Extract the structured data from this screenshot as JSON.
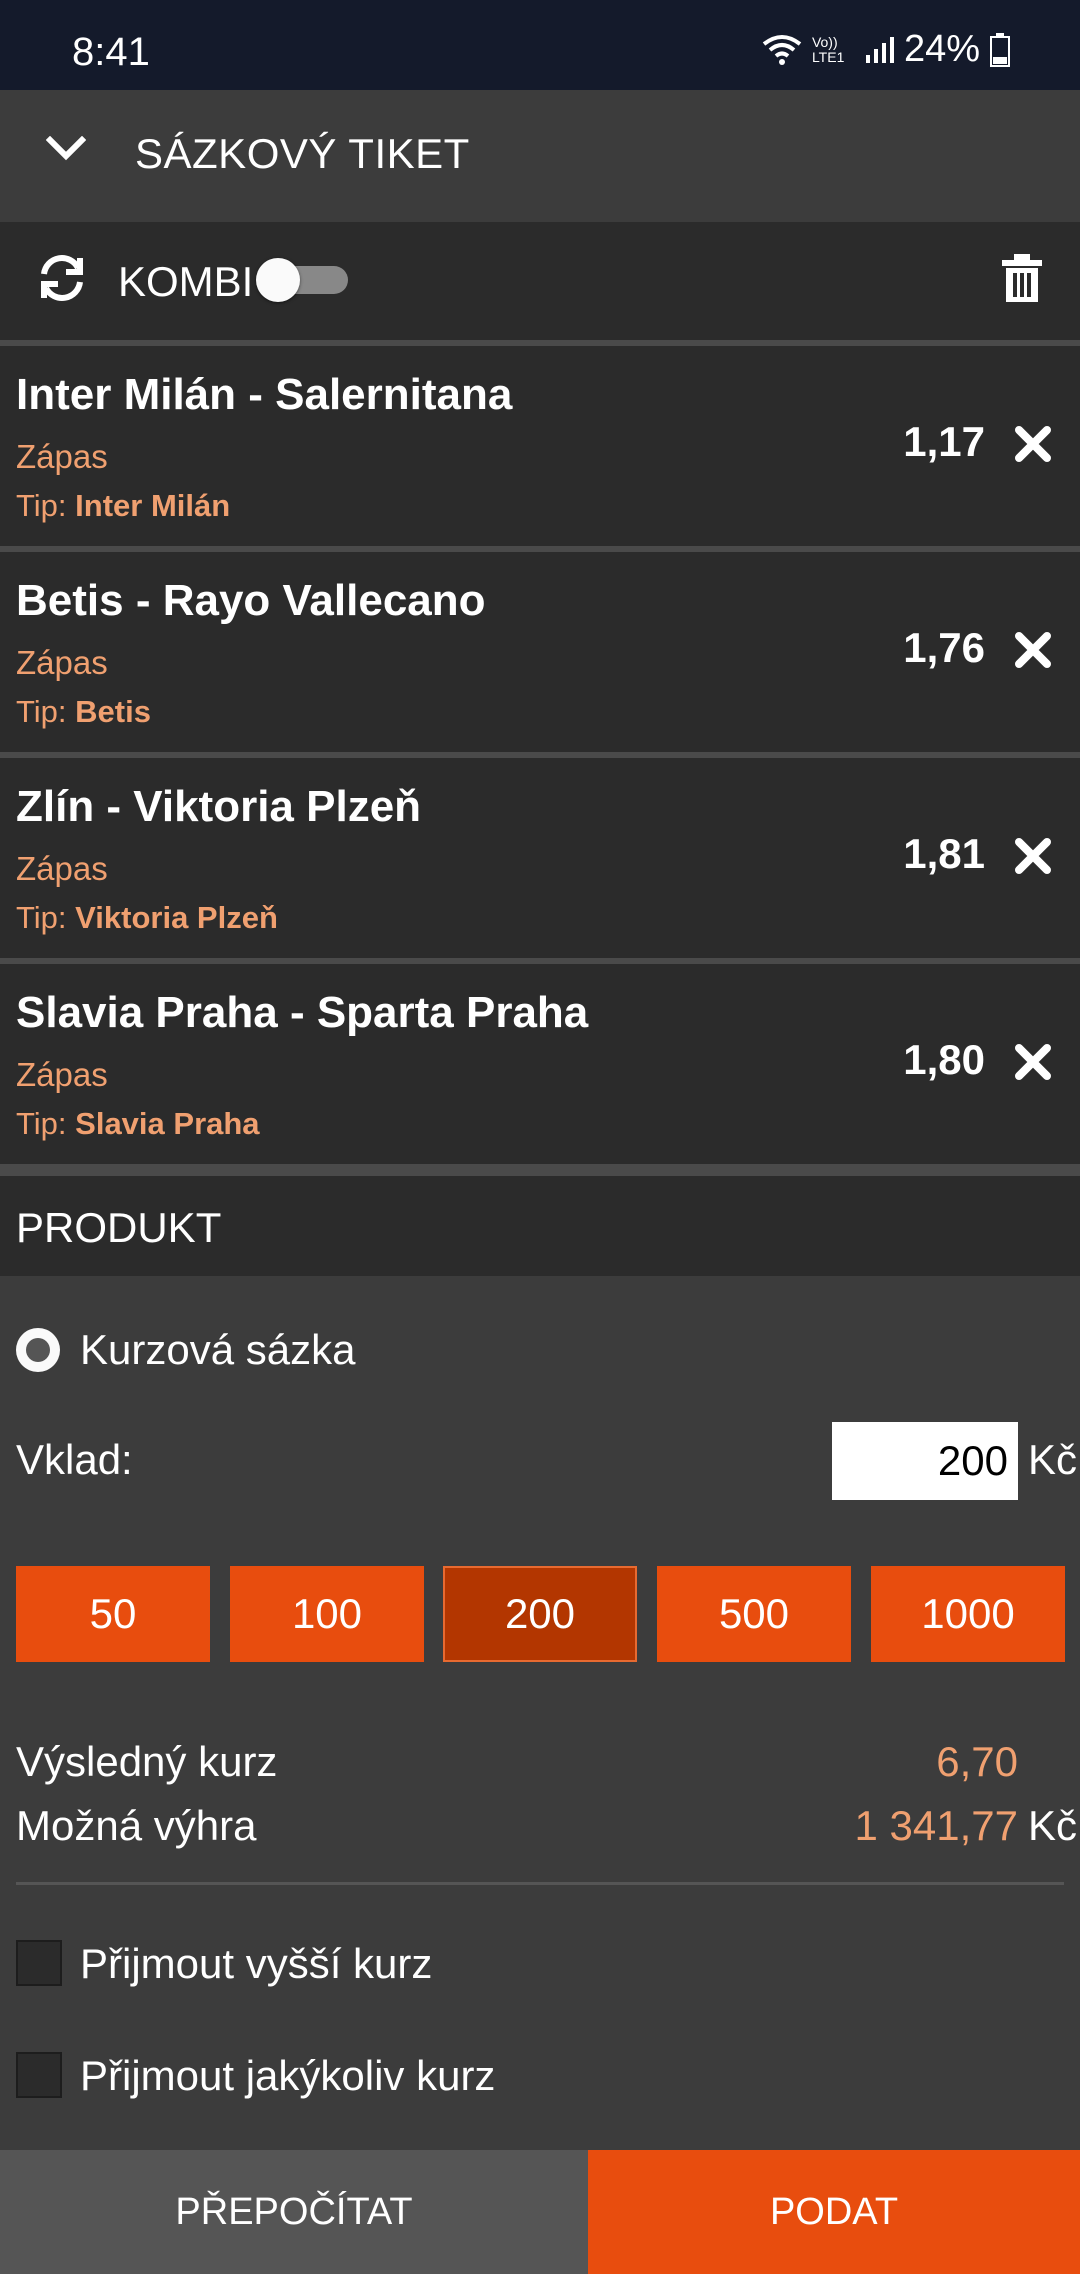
{
  "status_bar": {
    "time": "8:41",
    "volte": "Vo)) LTE1",
    "battery": "24%"
  },
  "header": {
    "title": "SÁZKOVÝ TIKET"
  },
  "toolbar": {
    "kombi_label": "KOMBI",
    "kombi_enabled": false
  },
  "bets": [
    {
      "match": "Inter Milán - Salernitana",
      "market": "Zápas",
      "tip_prefix": "Tip:",
      "tip": "Inter Milán",
      "odds": "1,17"
    },
    {
      "match": "Betis - Rayo Vallecano",
      "market": "Zápas",
      "tip_prefix": "Tip:",
      "tip": "Betis",
      "odds": "1,76"
    },
    {
      "match": "Zlín - Viktoria Plzeň",
      "market": "Zápas",
      "tip_prefix": "Tip:",
      "tip": "Viktoria Plzeň",
      "odds": "1,81"
    },
    {
      "match": "Slavia Praha - Sparta Praha",
      "market": "Zápas",
      "tip_prefix": "Tip:",
      "tip": "Slavia Praha",
      "odds": "1,80"
    }
  ],
  "product": {
    "heading": "PRODUKT",
    "option_label": "Kurzová sázka",
    "stake_label": "Vklad:",
    "stake_value": "200",
    "currency": "Kč",
    "quick_amounts": [
      "50",
      "100",
      "200",
      "500",
      "1000"
    ],
    "selected_amount": "200"
  },
  "result": {
    "odds_label": "Výsledný kurz",
    "odds_value": "6,70",
    "win_label": "Možná výhra",
    "win_value": "1 341,77",
    "currency": "Kč"
  },
  "options": {
    "accept_higher": "Přijmout vyšší kurz",
    "accept_any": "Přijmout jakýkoliv kurz"
  },
  "actions": {
    "recalculate": "PŘEPOČÍTAT",
    "submit": "PODAT"
  },
  "colors": {
    "accent": "#e84d0e",
    "accent_dark": "#b33600",
    "tip_text": "#f0a070",
    "panel": "#2b2b2b",
    "background": "#3c3c3c"
  }
}
